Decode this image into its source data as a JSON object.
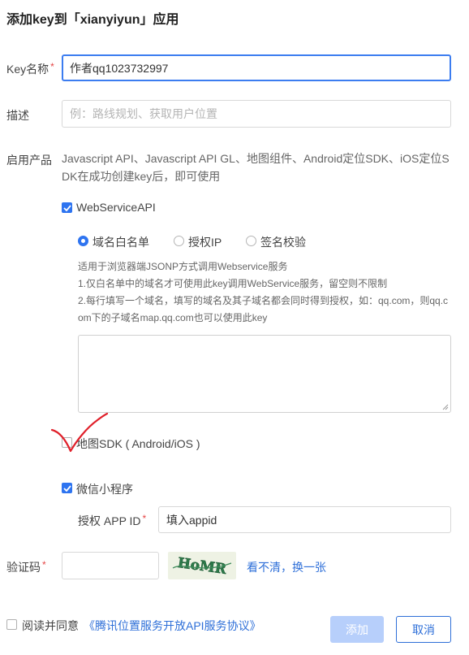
{
  "dialog": {
    "title": "添加key到「xianyiyun」应用"
  },
  "form": {
    "key_name": {
      "label": "Key名称",
      "required_mark": "*",
      "value": "作者qq1023732997"
    },
    "description": {
      "label": "描述",
      "placeholder": "例：路线规划、获取用户位置"
    },
    "products": {
      "label": "启用产品",
      "note_line1": "Javascript API、Javascript API GL、地图组件、Android定位SDK、iOS定位S",
      "note_line2": "DK在成功创建key后，即可使用",
      "webservice": {
        "label": "WebServiceAPI",
        "checked": true,
        "radio_options": [
          {
            "label": "域名白名单",
            "selected": true
          },
          {
            "label": "授权IP",
            "selected": false
          },
          {
            "label": "签名校验",
            "selected": false
          }
        ],
        "help_line1": "适用于浏览器端JSONP方式调用Webservice服务",
        "help_line2": "1.仅白名单中的域名才可使用此key调用WebService服务，留空则不限制",
        "help_line3": "2.每行填写一个域名，填写的域名及其子域名都会同时得到授权，如：qq.com，则qq.c",
        "help_line4": "om下的子域名map.qq.com也可以使用此key"
      },
      "map_sdk": {
        "label": "地图SDK ( Android/iOS )",
        "checked": false
      },
      "miniprogram": {
        "label": "微信小程序",
        "checked": true,
        "appid_label": "授权 APP ID",
        "appid_required_mark": "*",
        "appid_value": "填入appid"
      }
    },
    "captcha": {
      "label": "验证码",
      "required_mark": "*",
      "value": "",
      "image_text": "HoMR",
      "refresh_link": "看不清，换一张"
    }
  },
  "footer": {
    "agree_prefix": "阅读并同意",
    "agreement_link": "《腾讯位置服务开放API服务协议》",
    "agree_checked": false,
    "submit_label": "添加",
    "cancel_label": "取消"
  },
  "colors": {
    "accent": "#2e74f0",
    "annotation": "#e0202a"
  }
}
